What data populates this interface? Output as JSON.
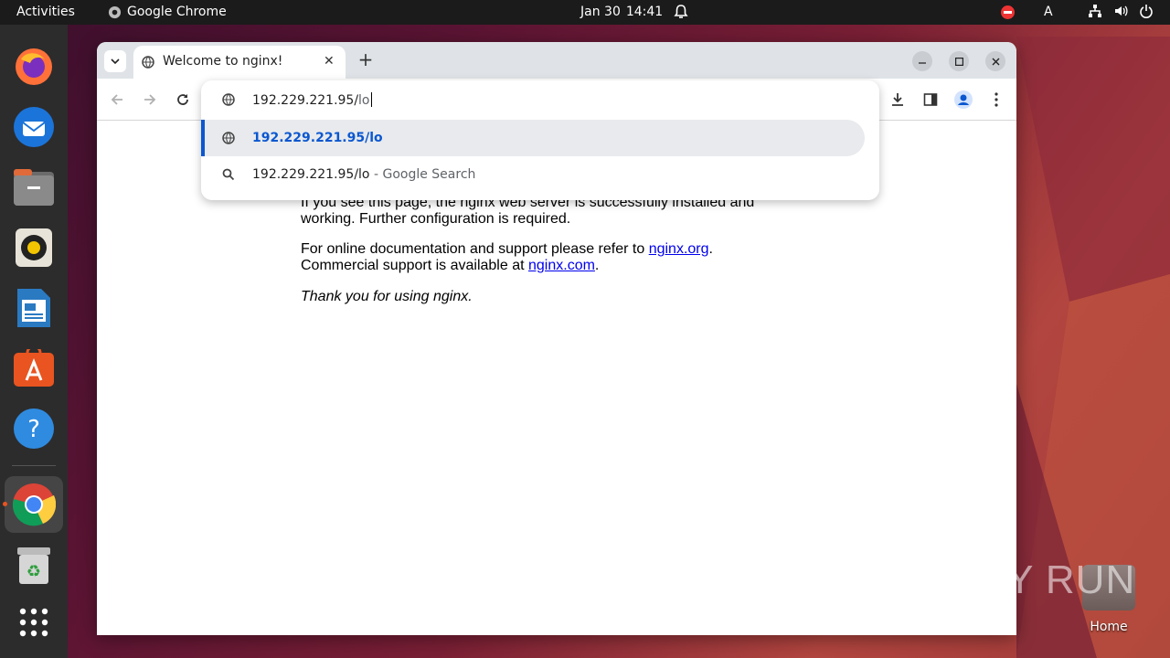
{
  "topbar": {
    "activities": "Activities",
    "app_name": "Google Chrome",
    "date": "Jan 30",
    "time": "14:41",
    "keyboard_layout": "A"
  },
  "dock": {
    "items": [
      "firefox-icon",
      "thunderbird-icon",
      "files-icon",
      "rhythmbox-icon",
      "libreoffice-writer-icon",
      "app-center-icon",
      "help-icon",
      "chrome-icon",
      "trash-icon",
      "show-apps-icon"
    ]
  },
  "browser": {
    "tab_title": "Welcome to nginx!",
    "omnibox": {
      "typed": "192.229.221.95/",
      "autocomplete": "lo",
      "suggestions": [
        {
          "text": "192.229.221.95/lo",
          "suffix": ""
        },
        {
          "text": "192.229.221.95/lo",
          "suffix": " - Google Search"
        }
      ]
    }
  },
  "page": {
    "para1": "If you see this page, the nginx web server is successfully installed and working. Further configuration is required.",
    "para2_a": "For online documentation and support please refer to ",
    "link1": "nginx.org",
    "para2_b": ".",
    "para2_c": "Commercial support is available at ",
    "link2": "nginx.com",
    "para2_d": ".",
    "para3": "Thank you for using nginx."
  },
  "desktop": {
    "watermark": "ANY RUN",
    "home_label": "Home"
  },
  "colors": {
    "accent": "#0b57d0",
    "ubuntu_orange": "#e95420",
    "link": "#0000ee"
  }
}
